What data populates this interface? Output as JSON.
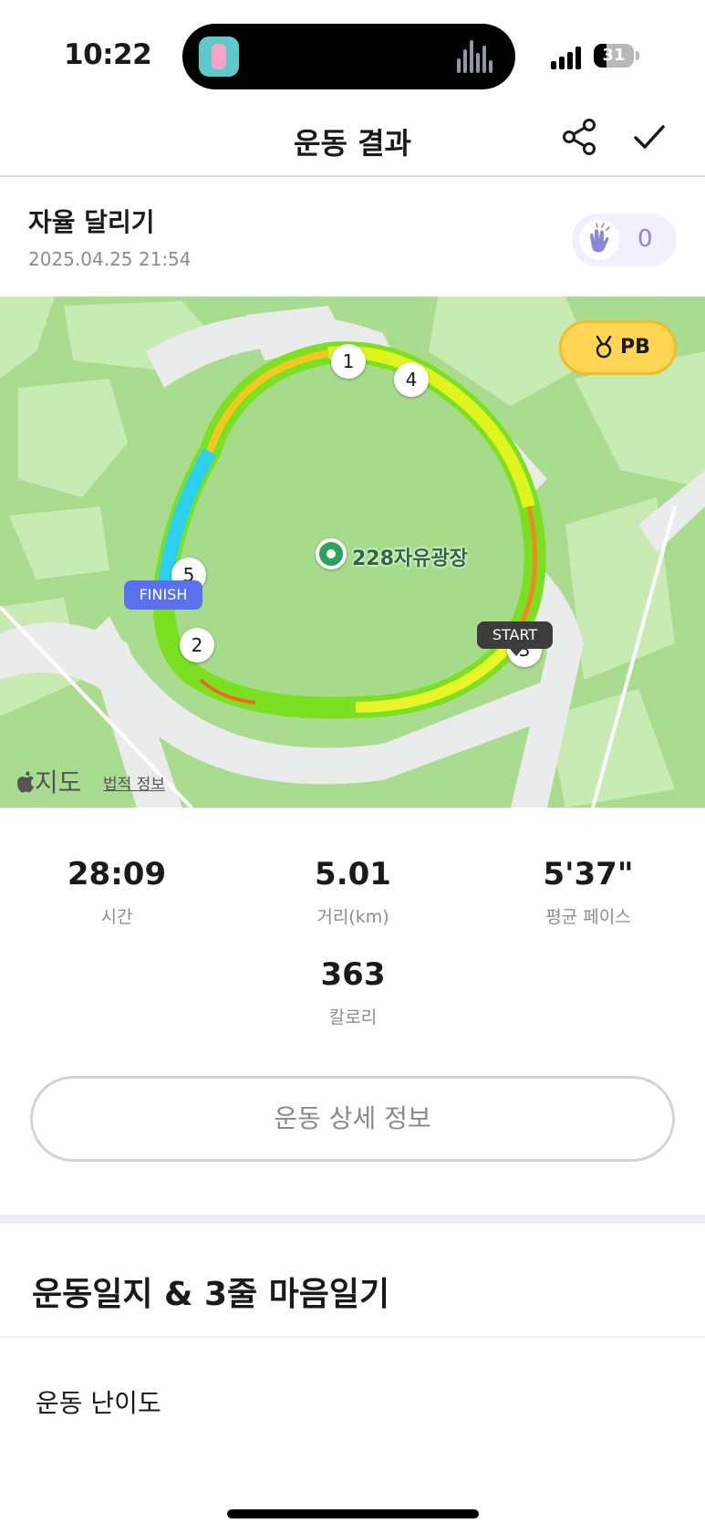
{
  "status_bar": {
    "time": "10:22",
    "battery": "31",
    "battery_level": 0.31
  },
  "header": {
    "title": "운동 결과",
    "share_icon": "share-icon",
    "done_icon": "check-icon"
  },
  "workout": {
    "title": "자율 달리기",
    "date": "2025.04.25 21:54",
    "clap_count": "0",
    "clap_icon": "clapping-hands-icon"
  },
  "map": {
    "pb_label": "PB",
    "pb_icon": "medal-icon",
    "poi_label": "228자유광장",
    "finish_label": "FINISH",
    "start_label": "START",
    "km_markers": [
      "1",
      "2",
      "3",
      "4",
      "5"
    ],
    "attribution": "지도",
    "legal_link": "법적 정보"
  },
  "stats": {
    "time": {
      "value": "28:09",
      "label": "시간"
    },
    "distance": {
      "value": "5.01",
      "label": "거리(km)"
    },
    "pace": {
      "value": "5'37\"",
      "label": "평균 페이스"
    },
    "calories": {
      "value": "363",
      "label": "칼로리"
    }
  },
  "detail_button": {
    "label": "운동 상세 정보"
  },
  "journal": {
    "title": "운동일지 & 3줄 마음일기",
    "difficulty_label": "운동 난이도"
  },
  "colors": {
    "accent": "#8d86d9",
    "finish": "#5b72f0",
    "pb": "#ffd553",
    "map_green": "#a9dc8e"
  }
}
